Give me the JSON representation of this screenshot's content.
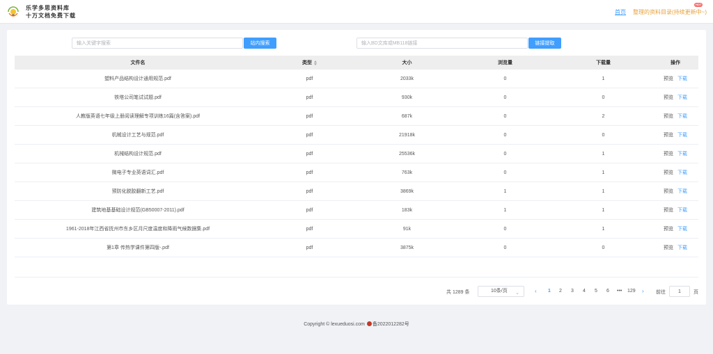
{
  "header": {
    "brand_line1": "乐学多思资料库",
    "brand_line2": "十万文档免费下载",
    "nav_home": "首页",
    "nav_list": "整理的资料目录(持续更新中~)",
    "hot_badge": "HOT"
  },
  "search": {
    "keyword_placeholder": "输入关键字搜索",
    "keyword_button": "站内搜索",
    "link_placeholder": "输入BD文库或MB118链接",
    "link_button": "链接提取"
  },
  "table": {
    "columns": [
      "文件名",
      "类型",
      "大小",
      "浏览量",
      "下载量",
      "操作"
    ],
    "preview_label": "预览",
    "download_label": "下载",
    "rows": [
      {
        "name": "塑料产品结构设计通用规范.pdf",
        "type": "pdf",
        "size": "2033k",
        "views": "0",
        "downloads": "1"
      },
      {
        "name": "铁塔公司笔试试题.pdf",
        "type": "pdf",
        "size": "930k",
        "views": "0",
        "downloads": "0"
      },
      {
        "name": "人教版英语七年级上册阅读理解专项训练16篇(含答案).pdf",
        "type": "pdf",
        "size": "687k",
        "views": "0",
        "downloads": "2"
      },
      {
        "name": "机械设计工艺与规范.pdf",
        "type": "pdf",
        "size": "21918k",
        "views": "0",
        "downloads": "0"
      },
      {
        "name": "机械结构设计规范.pdf",
        "type": "pdf",
        "size": "25536k",
        "views": "0",
        "downloads": "1"
      },
      {
        "name": "微电子专业英语词汇.pdf",
        "type": "pdf",
        "size": "763k",
        "views": "0",
        "downloads": "1"
      },
      {
        "name": "预防化脱胶翻新工艺.pdf",
        "type": "pdf",
        "size": "3869k",
        "views": "1",
        "downloads": "1"
      },
      {
        "name": "建筑地基基础设计规范(GB50007-2011).pdf",
        "type": "pdf",
        "size": "183k",
        "views": "1",
        "downloads": "1"
      },
      {
        "name": "1961-2018年江西省抚州市东乡区月尺度温度和降雨气候数据集.pdf",
        "type": "pdf",
        "size": "91k",
        "views": "0",
        "downloads": "1"
      },
      {
        "name": "第1章 传热学课件第四版-.pdf",
        "type": "pdf",
        "size": "3875k",
        "views": "0",
        "downloads": "0"
      }
    ]
  },
  "pagination": {
    "total": "共 1289 条",
    "page_size": "10条/页",
    "prev": "‹",
    "next": "›",
    "pages": [
      "1",
      "2",
      "3",
      "4",
      "5",
      "6",
      "•••",
      "129"
    ],
    "current": "1",
    "goto_label": "前往",
    "goto_value": "1",
    "page_label": "页"
  },
  "footer": {
    "copyright": "Copyright © lexueduosi.com",
    "icp": "备2022012282号"
  },
  "colors": {
    "accent": "#409eff",
    "nav_orange": "#e6a23c",
    "background": "#f0f2f5"
  }
}
